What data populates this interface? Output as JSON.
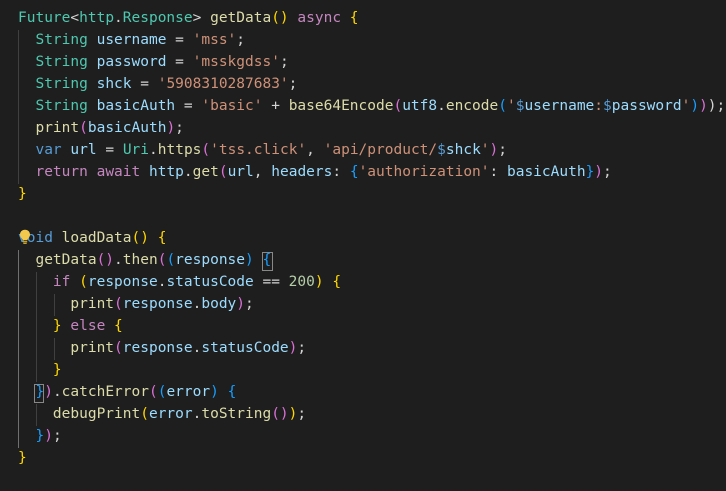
{
  "editor": {
    "lines": [
      [
        [
          "Future",
          "type"
        ],
        [
          "<",
          "p"
        ],
        [
          "http",
          "type"
        ],
        [
          ".",
          "p"
        ],
        [
          "Response",
          "type"
        ],
        [
          "> ",
          "p"
        ],
        [
          "getData",
          "fn"
        ],
        [
          "()",
          "b1"
        ],
        [
          " ",
          "p"
        ],
        [
          "async",
          "ctrl"
        ],
        [
          " ",
          "p"
        ],
        [
          "{",
          "b1"
        ]
      ],
      [
        [
          "  ",
          "p"
        ],
        [
          "String",
          "type"
        ],
        [
          " ",
          "p"
        ],
        [
          "username",
          "var"
        ],
        [
          " = ",
          "p"
        ],
        [
          "'mss'",
          "str"
        ],
        [
          ";",
          "p"
        ]
      ],
      [
        [
          "  ",
          "p"
        ],
        [
          "String",
          "type"
        ],
        [
          " ",
          "p"
        ],
        [
          "password",
          "var"
        ],
        [
          " = ",
          "p"
        ],
        [
          "'msskgdss'",
          "str"
        ],
        [
          ";",
          "p"
        ]
      ],
      [
        [
          "  ",
          "p"
        ],
        [
          "String",
          "type"
        ],
        [
          " ",
          "p"
        ],
        [
          "shck",
          "var"
        ],
        [
          " = ",
          "p"
        ],
        [
          "'5908310287683'",
          "str"
        ],
        [
          ";",
          "p"
        ]
      ],
      [
        [
          "  ",
          "p"
        ],
        [
          "String",
          "type"
        ],
        [
          " ",
          "p"
        ],
        [
          "basicAuth",
          "var"
        ],
        [
          " = ",
          "p"
        ],
        [
          "'basic'",
          "str"
        ],
        [
          " + ",
          "p"
        ],
        [
          "base64Encode",
          "fn"
        ],
        [
          "(",
          "b2"
        ],
        [
          "utf8",
          "var"
        ],
        [
          ".",
          "p"
        ],
        [
          "encode",
          "fn"
        ],
        [
          "(",
          "b3"
        ],
        [
          "'",
          "str"
        ],
        [
          "$",
          "key"
        ],
        [
          "username",
          "var"
        ],
        [
          ":",
          "str"
        ],
        [
          "$",
          "key"
        ],
        [
          "password",
          "var"
        ],
        [
          "'",
          "str"
        ],
        [
          ")",
          "b3"
        ],
        [
          ")",
          "b2"
        ],
        [
          ");",
          "p"
        ]
      ],
      [
        [
          "  ",
          "p"
        ],
        [
          "print",
          "fn"
        ],
        [
          "(",
          "b2"
        ],
        [
          "basicAuth",
          "var"
        ],
        [
          ")",
          "b2"
        ],
        [
          ";",
          "p"
        ]
      ],
      [
        [
          "  ",
          "p"
        ],
        [
          "var",
          "key"
        ],
        [
          " ",
          "p"
        ],
        [
          "url",
          "var"
        ],
        [
          " = ",
          "p"
        ],
        [
          "Uri",
          "type"
        ],
        [
          ".",
          "p"
        ],
        [
          "https",
          "fn"
        ],
        [
          "(",
          "b2"
        ],
        [
          "'tss.click'",
          "str"
        ],
        [
          ", ",
          "p"
        ],
        [
          "'api/product/",
          "str"
        ],
        [
          "$",
          "key"
        ],
        [
          "shck",
          "var"
        ],
        [
          "'",
          "str"
        ],
        [
          ")",
          "b2"
        ],
        [
          ";",
          "p"
        ]
      ],
      [
        [
          "  ",
          "p"
        ],
        [
          "return",
          "ctrl"
        ],
        [
          " ",
          "p"
        ],
        [
          "await",
          "ctrl"
        ],
        [
          " ",
          "p"
        ],
        [
          "http",
          "var"
        ],
        [
          ".",
          "p"
        ],
        [
          "get",
          "fn"
        ],
        [
          "(",
          "b2"
        ],
        [
          "url",
          "var"
        ],
        [
          ", ",
          "p"
        ],
        [
          "headers",
          "var"
        ],
        [
          ": ",
          "p"
        ],
        [
          "{",
          "b3"
        ],
        [
          "'authorization'",
          "str"
        ],
        [
          ": ",
          "p"
        ],
        [
          "basicAuth",
          "var"
        ],
        [
          "}",
          "b3"
        ],
        [
          ")",
          "b2"
        ],
        [
          ";",
          "p"
        ]
      ],
      [
        [
          "}",
          "b1"
        ]
      ],
      [],
      [
        [
          "void",
          "key"
        ],
        [
          " ",
          "p"
        ],
        [
          "loadData",
          "fn"
        ],
        [
          "()",
          "b1"
        ],
        [
          " ",
          "p"
        ],
        [
          "{",
          "b1"
        ]
      ],
      [
        [
          "  ",
          "p"
        ],
        [
          "getData",
          "fn"
        ],
        [
          "()",
          "b2"
        ],
        [
          ".",
          "p"
        ],
        [
          "then",
          "fn"
        ],
        [
          "(",
          "b2"
        ],
        [
          "(",
          "b3"
        ],
        [
          "response",
          "var"
        ],
        [
          ")",
          "b3"
        ],
        [
          " ",
          "p"
        ],
        [
          "{",
          "b3"
        ]
      ],
      [
        [
          "    ",
          "p"
        ],
        [
          "if",
          "ctrl"
        ],
        [
          " ",
          "p"
        ],
        [
          "(",
          "b1"
        ],
        [
          "response",
          "var"
        ],
        [
          ".",
          "p"
        ],
        [
          "statusCode",
          "var"
        ],
        [
          " == ",
          "p"
        ],
        [
          "200",
          "num"
        ],
        [
          ")",
          "b1"
        ],
        [
          " ",
          "p"
        ],
        [
          "{",
          "b1"
        ]
      ],
      [
        [
          "      ",
          "p"
        ],
        [
          "print",
          "fn"
        ],
        [
          "(",
          "b2"
        ],
        [
          "response",
          "var"
        ],
        [
          ".",
          "p"
        ],
        [
          "body",
          "var"
        ],
        [
          ")",
          "b2"
        ],
        [
          ";",
          "p"
        ]
      ],
      [
        [
          "    ",
          "p"
        ],
        [
          "}",
          "b1"
        ],
        [
          " ",
          "p"
        ],
        [
          "else",
          "ctrl"
        ],
        [
          " ",
          "p"
        ],
        [
          "{",
          "b1"
        ]
      ],
      [
        [
          "      ",
          "p"
        ],
        [
          "print",
          "fn"
        ],
        [
          "(",
          "b2"
        ],
        [
          "response",
          "var"
        ],
        [
          ".",
          "p"
        ],
        [
          "statusCode",
          "var"
        ],
        [
          ")",
          "b2"
        ],
        [
          ";",
          "p"
        ]
      ],
      [
        [
          "    ",
          "p"
        ],
        [
          "}",
          "b1"
        ]
      ],
      [
        [
          "  ",
          "p"
        ],
        [
          "}",
          "b3"
        ],
        [
          ")",
          "b2"
        ],
        [
          ".",
          "p"
        ],
        [
          "catchError",
          "fn"
        ],
        [
          "(",
          "b2"
        ],
        [
          "(",
          "b3"
        ],
        [
          "error",
          "var"
        ],
        [
          ")",
          "b3"
        ],
        [
          " ",
          "p"
        ],
        [
          "{",
          "b3"
        ]
      ],
      [
        [
          "    ",
          "p"
        ],
        [
          "debugPrint",
          "fn"
        ],
        [
          "(",
          "b1"
        ],
        [
          "error",
          "var"
        ],
        [
          ".",
          "p"
        ],
        [
          "toString",
          "fn"
        ],
        [
          "()",
          "b2"
        ],
        [
          ")",
          "b1"
        ],
        [
          ";",
          "p"
        ]
      ],
      [
        [
          "  ",
          "p"
        ],
        [
          "}",
          "b3"
        ],
        [
          ")",
          "b2"
        ],
        [
          ";",
          "p"
        ]
      ],
      [
        [
          "}",
          "b1"
        ]
      ]
    ],
    "colors": {
      "background": "#1e1e1e",
      "keyword": "#569cd6",
      "control": "#c586c0",
      "type": "#4ec9b0",
      "function": "#dcdcaa",
      "variable": "#9cdcfe",
      "string": "#ce9178",
      "number": "#b5cea8",
      "bracket_gold": "#ffd700",
      "bracket_orchid": "#da70d6",
      "bracket_blue": "#179fff"
    },
    "lightbulb_icon": "lightbulb-icon"
  }
}
